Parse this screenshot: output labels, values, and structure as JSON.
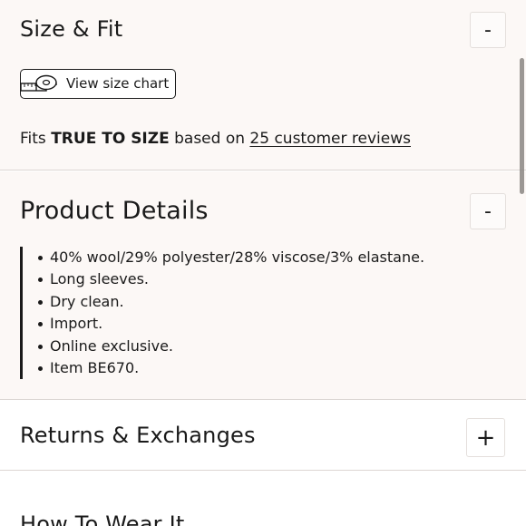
{
  "size_fit": {
    "title": "Size & Fit",
    "toggle": "-",
    "size_chart_label": "View size chart",
    "fits_prefix": "Fits ",
    "fits_value": "TRUE TO SIZE",
    "fits_middle": " based on ",
    "reviews_link": "25 customer reviews"
  },
  "product_details": {
    "title": "Product Details",
    "toggle": "-",
    "items": [
      "40% wool/29% polyester/28% viscose/3% elastane.",
      "Long sleeves.",
      "Dry clean.",
      "Import.",
      "Online exclusive.",
      "Item BE670."
    ]
  },
  "returns": {
    "title": "Returns & Exchanges",
    "toggle": "+"
  },
  "how_to_wear": {
    "title": "How To Wear It"
  },
  "icons": {
    "size_chart": "measuring-tape-icon"
  },
  "colors": {
    "background_expanded": "#fcf8f6",
    "text": "#1a1a1a",
    "divider": "#dcd6d3"
  }
}
